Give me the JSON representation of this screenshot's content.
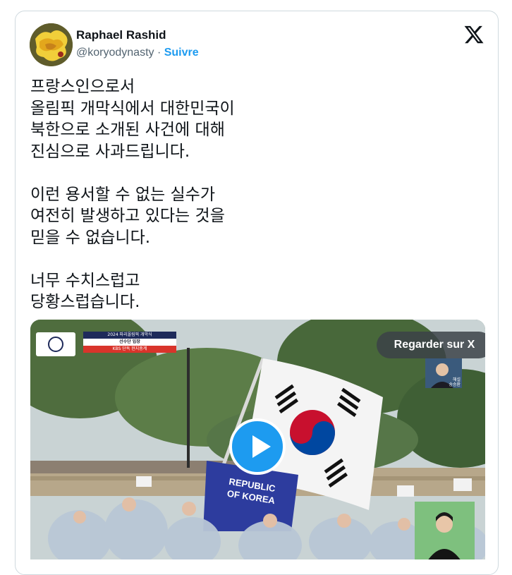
{
  "author": {
    "name": "Raphael Rashid",
    "handle": "@koryodynasty",
    "separator": " · ",
    "follow_label": "Suivre"
  },
  "tweet": {
    "text": "프랑스인으로서\n올림픽 개막식에서 대한민국이\n북한으로 소개된 사건에 대해\n진심으로 사과드립니다.\n\n이런 용서할 수 없는 실수가\n여전히 발생하고 있다는 것을\n믿을 수 없습니다.\n\n너무 수치스럽고\n당황스럽습니다."
  },
  "media": {
    "watch_label": "Regarder sur X",
    "broadcast_lines": [
      "2024 파리올림픽 개막식",
      "선수단 입장",
      "KBS 단독 현지중계"
    ],
    "caster_name": [
      "해설",
      "송승환"
    ],
    "flag_text": [
      "REPUBLIC",
      "OF KOREA"
    ]
  },
  "icons": {
    "logo": "x-logo-icon",
    "play": "play-icon"
  },
  "colors": {
    "accent": "#1d9bf0",
    "text": "#0f1419",
    "secondary": "#536471",
    "border": "#cfd9de"
  }
}
